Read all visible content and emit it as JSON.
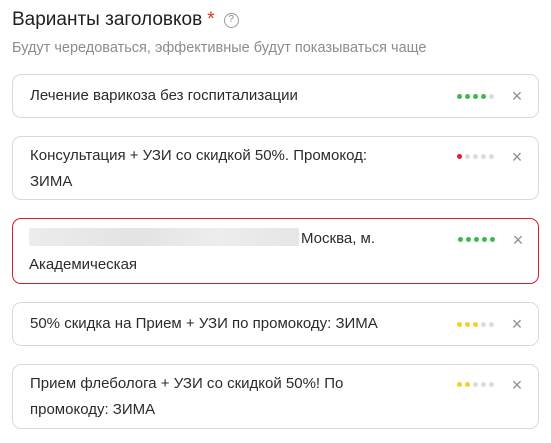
{
  "field": {
    "title": "Варианты заголовков",
    "required_mark": "*",
    "help_icon": "?",
    "subtitle": "Будут чередоваться, эффективные будут показываться чаще"
  },
  "quality_colors": {
    "green": "#3cb94a",
    "yellow": "#f5cf2a",
    "red": "#d9262c",
    "empty": "#dcdcdc"
  },
  "headlines": [
    {
      "text": "Лечение варикоза без госпитализации",
      "score": 4,
      "color": "green"
    },
    {
      "text_line1": "Консультация + УЗИ со скидкой 50%. Промокод:",
      "text_line2": "ЗИМА",
      "score": 1,
      "color": "red"
    },
    {
      "text_visible_line1": "Москва, м.",
      "text_line2": "Академическая",
      "score": 5,
      "color": "green",
      "active": true
    },
    {
      "text": "50% скидка на Прием + УЗИ по промокоду: ЗИМА",
      "score": 3,
      "color": "yellow"
    },
    {
      "text_line1": "Прием флеболога + УЗИ со скидкой 50%! По",
      "text_line2": "промокоду: ЗИМА",
      "score": 2,
      "color": "yellow"
    }
  ],
  "close_icon": "×"
}
